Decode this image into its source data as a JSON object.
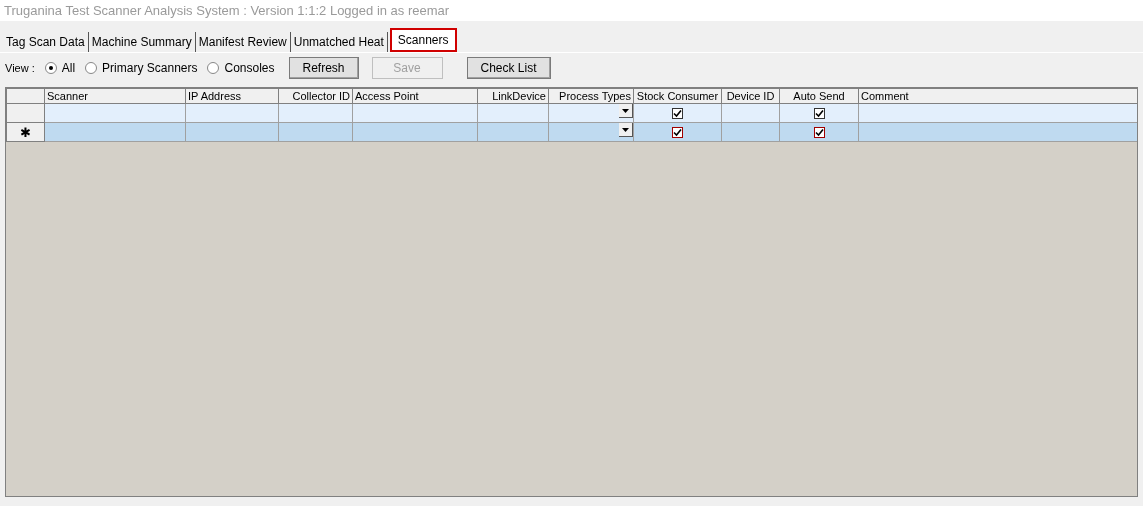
{
  "window": {
    "title": "Truganina Test Scanner Analysis System : Version 1:1:2 Logged in as reemar"
  },
  "tabs": [
    {
      "label": "Tag Scan Data",
      "selected": false
    },
    {
      "label": "Machine Summary",
      "selected": false
    },
    {
      "label": "Manifest Review",
      "selected": false
    },
    {
      "label": "Unmatched Heat",
      "selected": false
    },
    {
      "label": "Scanners",
      "selected": true
    }
  ],
  "view": {
    "label": "View :",
    "options": [
      {
        "label": "All",
        "selected": true
      },
      {
        "label": "Primary Scanners",
        "selected": false
      },
      {
        "label": "Consoles",
        "selected": false
      }
    ]
  },
  "buttons": [
    {
      "label": "Refresh",
      "disabled": false
    },
    {
      "label": "Save",
      "disabled": true
    },
    {
      "label": "Check List",
      "disabled": false
    }
  ],
  "table": {
    "columns": [
      "Scanner",
      "IP Address",
      "Collector ID",
      "Access Point",
      "LinkDevice",
      "Process Types",
      "Stock Consumer",
      "Device ID",
      "Auto Send",
      "Comment"
    ],
    "rows": [
      {
        "selected": false,
        "stock_consumer": {
          "checked": true
        },
        "auto_send": {
          "checked": true
        }
      },
      {
        "selected": true,
        "marker": "✱",
        "stock_consumer": {
          "checked": true
        },
        "auto_send": {
          "checked": true
        }
      }
    ]
  }
}
